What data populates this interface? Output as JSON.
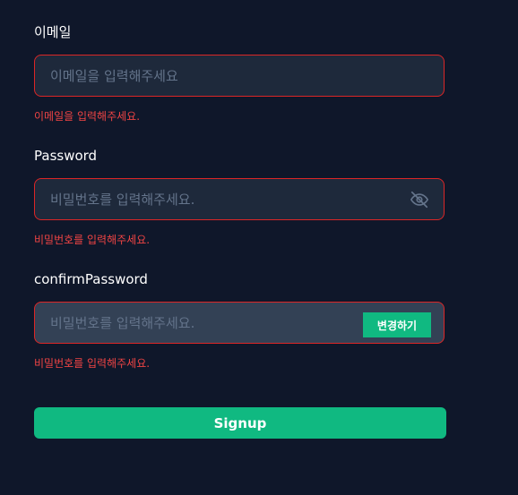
{
  "email": {
    "label": "이메일",
    "placeholder": "이메일을 입력해주세요",
    "value": "",
    "error": "이메일을 입력해주세요."
  },
  "password": {
    "label": "Password",
    "placeholder": "비밀번호를 입력해주세요.",
    "value": "",
    "error": "비밀번호를 입력해주세요.",
    "toggle_icon": "eye-off-icon"
  },
  "confirm_password": {
    "label": "confirmPassword",
    "placeholder": "비밀번호를 입력해주세요.",
    "value": "",
    "error": "비밀번호를 입력해주세요.",
    "change_label": "변경하기"
  },
  "signup": {
    "label": "Signup"
  },
  "colors": {
    "background": "#0f172a",
    "input_bg": "#1e293b",
    "error": "#ef4444",
    "accent": "#10b981"
  }
}
